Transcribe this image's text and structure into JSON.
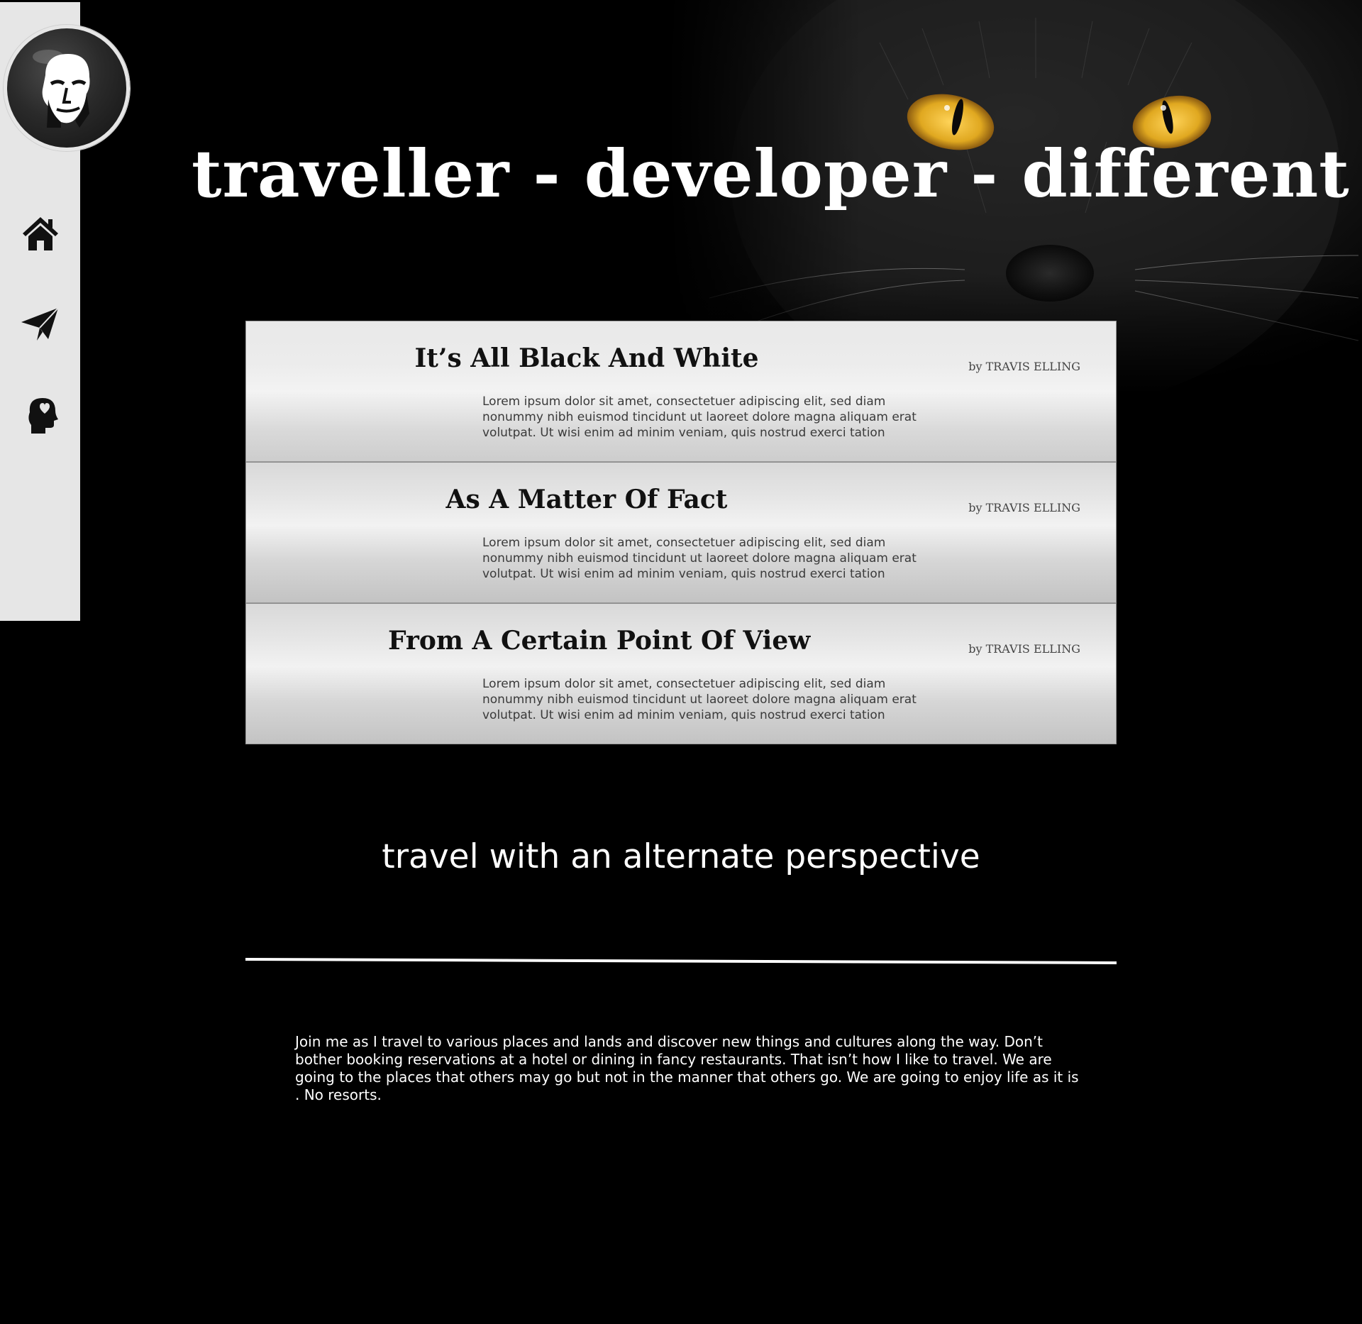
{
  "hero": {
    "title": "traveller - developer - different"
  },
  "sidebar": {
    "items": [
      {
        "name": "home",
        "icon": "home-icon"
      },
      {
        "name": "travel",
        "icon": "paper-plane-icon"
      },
      {
        "name": "about",
        "icon": "head-heart-icon"
      }
    ]
  },
  "articles": [
    {
      "title": "It’s All Black And White",
      "author": "by TRAVIS ELLING",
      "excerpt": "Lorem ipsum dolor sit amet, consectetuer adipiscing elit, sed diam nonummy nibh euismod tincidunt ut laoreet dolore magna aliquam erat volutpat. Ut wisi enim ad minim veniam, quis nostrud exerci tation"
    },
    {
      "title": "As A Matter Of Fact",
      "author": "by TRAVIS ELLING",
      "excerpt": "Lorem ipsum dolor sit amet, consectetuer adipiscing elit, sed diam nonummy nibh euismod tincidunt ut laoreet dolore magna aliquam erat volutpat. Ut wisi enim ad minim veniam, quis nostrud exerci tation"
    },
    {
      "title": "From A Certain Point Of View",
      "author": "by TRAVIS ELLING",
      "excerpt": "Lorem ipsum dolor sit amet, consectetuer adipiscing elit, sed diam nonummy nibh euismod tincidunt ut laoreet dolore magna aliquam erat volutpat. Ut wisi enim ad minim veniam, quis nostrud exerci tation"
    }
  ],
  "tagline": "travel with an alternate perspective",
  "intro": "Join me as I travel to various places and lands and discover new things and cultures along the way. Don’t bother booking reservations at a hotel or dining in fancy restaurants. That isn’t how I like to travel. We are going to the places that others may go but  not in the manner that others go. We are going to enjoy life as it is . No resorts.",
  "colors": {
    "background": "#000000",
    "sidebar": "#e6e6e6",
    "cat_eyes": "#e0a820",
    "text_light": "#ffffff",
    "text_dark": "#111111"
  }
}
